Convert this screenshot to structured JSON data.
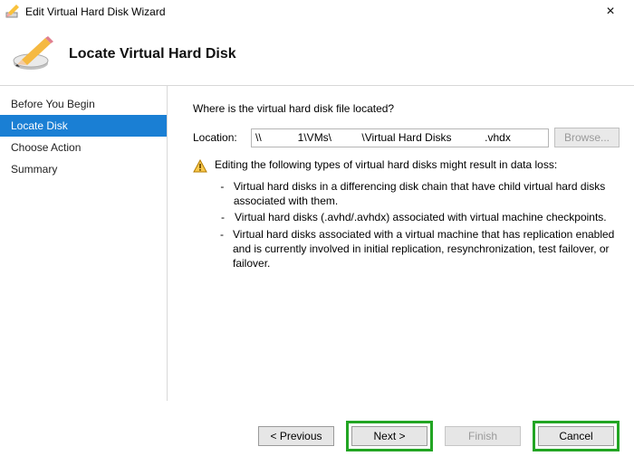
{
  "window": {
    "title": "Edit Virtual Hard Disk Wizard",
    "close": "×"
  },
  "header": {
    "heading": "Locate Virtual Hard Disk"
  },
  "sidebar": {
    "items": [
      {
        "label": "Before You Begin"
      },
      {
        "label": "Locate Disk"
      },
      {
        "label": "Choose Action"
      },
      {
        "label": "Summary"
      }
    ]
  },
  "content": {
    "prompt": "Where is the virtual hard disk file located?",
    "location_label": "Location:",
    "location_value": "\\\\            1\\VMs\\          \\Virtual Hard Disks           .vhdx",
    "browse_label": "Browse...",
    "warning_text": "Editing the following types of virtual hard disks might result in data loss:",
    "bullets": [
      "Virtual hard disks in a differencing disk chain that have child virtual hard disks associated with them.",
      "Virtual hard disks (.avhd/.avhdx) associated with virtual machine checkpoints.",
      "Virtual hard disks associated with a virtual machine that has replication enabled and is currently involved in initial replication, resynchronization, test failover, or failover."
    ]
  },
  "footer": {
    "previous": "< Previous",
    "next": "Next >",
    "finish": "Finish",
    "cancel": "Cancel"
  }
}
